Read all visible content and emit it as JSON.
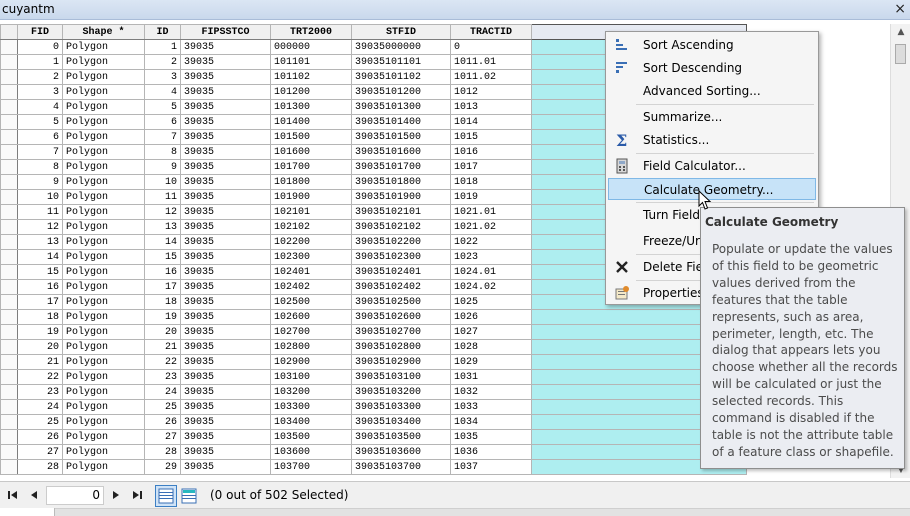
{
  "window": {
    "title": "cuyantm",
    "close_glyph": "×"
  },
  "table": {
    "columns": [
      "FID",
      "Shape *",
      "ID",
      "FIPSSTCO",
      "TRT2000",
      "STFID",
      "TRACTID",
      ""
    ],
    "rows": [
      [
        "0",
        "Polygon",
        "1",
        "39035",
        "000000",
        "39035000000",
        "0",
        ""
      ],
      [
        "1",
        "Polygon",
        "2",
        "39035",
        "101101",
        "39035101101",
        "1011.01",
        ""
      ],
      [
        "2",
        "Polygon",
        "3",
        "39035",
        "101102",
        "39035101102",
        "1011.02",
        ""
      ],
      [
        "3",
        "Polygon",
        "4",
        "39035",
        "101200",
        "39035101200",
        "1012",
        ""
      ],
      [
        "4",
        "Polygon",
        "5",
        "39035",
        "101300",
        "39035101300",
        "1013",
        ""
      ],
      [
        "5",
        "Polygon",
        "6",
        "39035",
        "101400",
        "39035101400",
        "1014",
        ""
      ],
      [
        "6",
        "Polygon",
        "7",
        "39035",
        "101500",
        "39035101500",
        "1015",
        ""
      ],
      [
        "7",
        "Polygon",
        "8",
        "39035",
        "101600",
        "39035101600",
        "1016",
        ""
      ],
      [
        "8",
        "Polygon",
        "9",
        "39035",
        "101700",
        "39035101700",
        "1017",
        ""
      ],
      [
        "9",
        "Polygon",
        "10",
        "39035",
        "101800",
        "39035101800",
        "1018",
        ""
      ],
      [
        "10",
        "Polygon",
        "11",
        "39035",
        "101900",
        "39035101900",
        "1019",
        ""
      ],
      [
        "11",
        "Polygon",
        "12",
        "39035",
        "102101",
        "39035102101",
        "1021.01",
        ""
      ],
      [
        "12",
        "Polygon",
        "13",
        "39035",
        "102102",
        "39035102102",
        "1021.02",
        ""
      ],
      [
        "13",
        "Polygon",
        "14",
        "39035",
        "102200",
        "39035102200",
        "1022",
        ""
      ],
      [
        "14",
        "Polygon",
        "15",
        "39035",
        "102300",
        "39035102300",
        "1023",
        ""
      ],
      [
        "15",
        "Polygon",
        "16",
        "39035",
        "102401",
        "39035102401",
        "1024.01",
        ""
      ],
      [
        "16",
        "Polygon",
        "17",
        "39035",
        "102402",
        "39035102402",
        "1024.02",
        ""
      ],
      [
        "17",
        "Polygon",
        "18",
        "39035",
        "102500",
        "39035102500",
        "1025",
        ""
      ],
      [
        "18",
        "Polygon",
        "19",
        "39035",
        "102600",
        "39035102600",
        "1026",
        ""
      ],
      [
        "19",
        "Polygon",
        "20",
        "39035",
        "102700",
        "39035102700",
        "1027",
        ""
      ],
      [
        "20",
        "Polygon",
        "21",
        "39035",
        "102800",
        "39035102800",
        "1028",
        ""
      ],
      [
        "21",
        "Polygon",
        "22",
        "39035",
        "102900",
        "39035102900",
        "1029",
        ""
      ],
      [
        "22",
        "Polygon",
        "23",
        "39035",
        "103100",
        "39035103100",
        "1031",
        ""
      ],
      [
        "23",
        "Polygon",
        "24",
        "39035",
        "103200",
        "39035103200",
        "1032",
        ""
      ],
      [
        "24",
        "Polygon",
        "25",
        "39035",
        "103300",
        "39035103300",
        "1033",
        ""
      ],
      [
        "25",
        "Polygon",
        "26",
        "39035",
        "103400",
        "39035103400",
        "1034",
        ""
      ],
      [
        "26",
        "Polygon",
        "27",
        "39035",
        "103500",
        "39035103500",
        "1035",
        ""
      ],
      [
        "27",
        "Polygon",
        "28",
        "39035",
        "103600",
        "39035103600",
        "1036",
        ""
      ],
      [
        "28",
        "Polygon",
        "29",
        "39035",
        "103700",
        "39035103700",
        "1037",
        ""
      ]
    ],
    "highlight_color": "#aeeef0"
  },
  "context_menu": {
    "items": [
      {
        "label": "Sort Ascending",
        "icon": "sort-ascending-icon"
      },
      {
        "label": "Sort Descending",
        "icon": "sort-descending-icon"
      },
      {
        "label": "Advanced Sorting...",
        "icon": ""
      },
      {
        "label": "Summarize...",
        "icon": ""
      },
      {
        "label": "Statistics...",
        "icon": "sigma-icon"
      },
      {
        "label": "Field Calculator...",
        "icon": "calculator-icon"
      },
      {
        "label": "Calculate Geometry...",
        "icon": "",
        "active": true
      },
      {
        "label": "Turn Field",
        "icon": ""
      },
      {
        "label": "Freeze/Ur",
        "icon": ""
      },
      {
        "label": "Delete Fie",
        "icon": "delete-icon"
      },
      {
        "label": "Properties",
        "icon": "properties-icon"
      }
    ]
  },
  "tooltip": {
    "title": "Calculate Geometry",
    "lines": [
      "Populate or update the values",
      "of this field to be geometric",
      "values derived from the",
      "features that the table",
      "represents, such as area,",
      "perimeter, length, etc. The",
      "dialog that appears lets you",
      "choose whether all the records",
      "will be calculated or just the",
      "selected records. This",
      "command is disabled if the",
      "table is not the attribute table",
      "of a feature class or shapefile."
    ]
  },
  "statusbar": {
    "record": "0",
    "selection": "(0 out of 502 Selected)"
  }
}
